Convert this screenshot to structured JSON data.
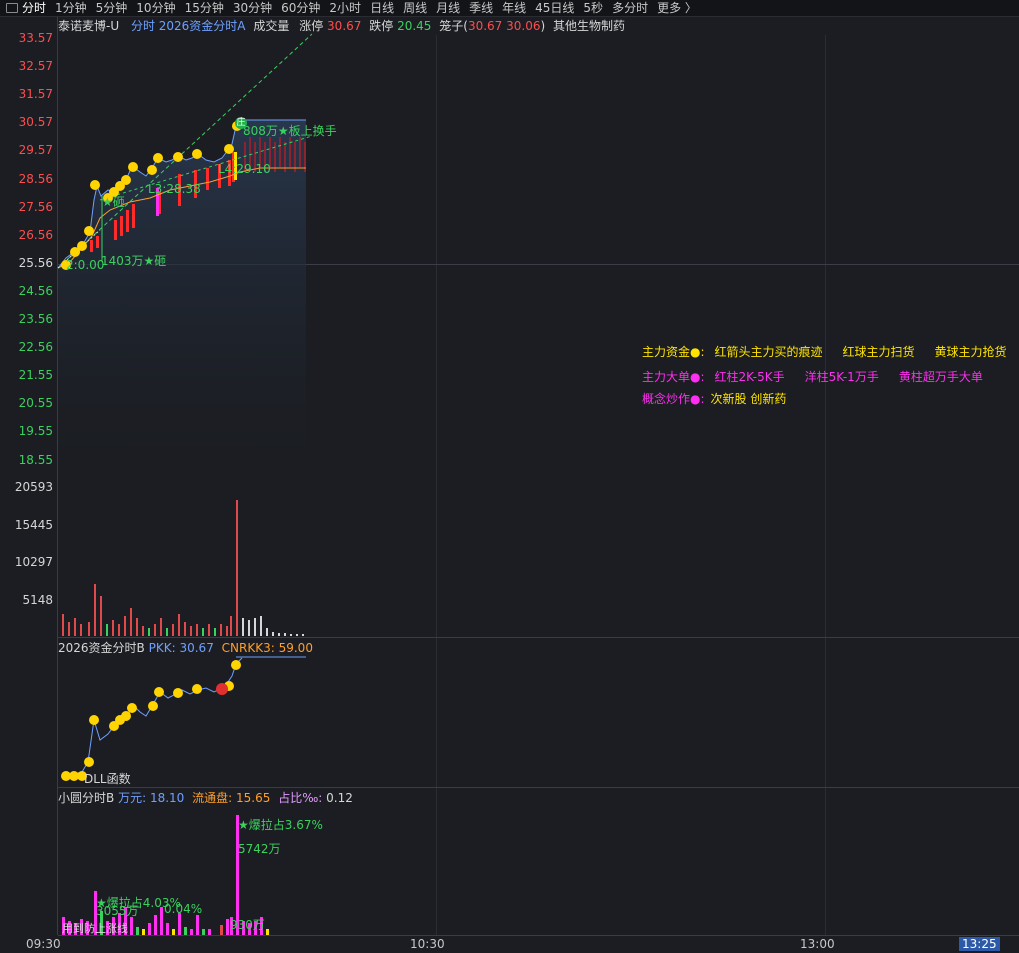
{
  "tabs": [
    "分时",
    "1分钟",
    "5分钟",
    "10分钟",
    "15分钟",
    "30分钟",
    "60分钟",
    "2小时",
    "日线",
    "周线",
    "月线",
    "季线",
    "年线",
    "45日线",
    "5秒",
    "多分时",
    "更多 〉"
  ],
  "header": {
    "stock_name": "泰诺麦博-U",
    "indicator": "分时 2026资金分时A",
    "volume_label": "成交量",
    "limit_up_label": "涨停",
    "limit_up_value": "30.67",
    "limit_down_label": "跌停",
    "limit_down_value": "20.45",
    "cage_label": "笼子(",
    "cage_values": "30.67 30.06",
    "cage_close": ")",
    "sector": "其他生物制药"
  },
  "price_axis": [
    {
      "v": "33.57",
      "c": "red"
    },
    {
      "v": "32.57",
      "c": "red"
    },
    {
      "v": "31.57",
      "c": "red"
    },
    {
      "v": "30.57",
      "c": "red"
    },
    {
      "v": "29.57",
      "c": "red"
    },
    {
      "v": "28.56",
      "c": "red"
    },
    {
      "v": "27.56",
      "c": "red"
    },
    {
      "v": "26.56",
      "c": "red"
    },
    {
      "v": "25.56",
      "c": "wht"
    },
    {
      "v": "24.56",
      "c": "grn"
    },
    {
      "v": "23.56",
      "c": "grn"
    },
    {
      "v": "22.56",
      "c": "grn"
    },
    {
      "v": "21.55",
      "c": "grn"
    },
    {
      "v": "20.55",
      "c": "grn"
    },
    {
      "v": "19.55",
      "c": "grn"
    },
    {
      "v": "18.55",
      "c": "grn"
    }
  ],
  "volume_axis": [
    "20593",
    "15445",
    "10297",
    "5148"
  ],
  "annotations": {
    "a1": "2:0.00",
    "a2": "1403万★砸",
    "a3": "★砸",
    "a4": "L3:28.38",
    "a5": "L4:29.10",
    "a6": "808万★板上换手",
    "sub1_bottom": "DLL函数",
    "burst1": "★爆拉占3.67%",
    "burst1_amt": "5742万",
    "burst2": "★爆拉占4.03%",
    "burst2_amt": "3055万",
    "burst2_pct": "0.04%",
    "burst3_amt": "930万",
    "bottom_left": "用到防上涨线"
  },
  "legend": {
    "row1": {
      "label": "主力资金●:",
      "items": [
        "红箭头主力买的痕迹",
        "红球主力扫货",
        "黄球主力抢货"
      ]
    },
    "row2": {
      "label": "主力大单●:",
      "items": [
        "红柱2K-5K手",
        "洋柱5K-1万手",
        "黄柱超万手大单"
      ]
    },
    "row3": {
      "label": "概念炒作●:",
      "items": [
        "次新股 创新药"
      ]
    }
  },
  "sub1": {
    "title": "2026资金分时B",
    "pkk_label": "PKK:",
    "pkk_value": "30.67",
    "cnr_label": "CNRKK3:",
    "cnr_value": "59.00"
  },
  "sub2": {
    "title": "小圆分时B",
    "wan_label": "万元:",
    "wan_value": "18.10",
    "float_label": "流通盘:",
    "float_value": "15.65",
    "ratio_label": "占比‰:",
    "ratio_value": "0.12"
  },
  "x_axis": {
    "start": "09:30",
    "mid": "10:30",
    "after": "13:00",
    "cursor": "13:25"
  },
  "colors": {
    "up": "#ff4d4d",
    "down": "#3bd15e",
    "price_line": "#6fa0ff",
    "avg_line": "#ff9e2c",
    "yellow_ball": "#ffd400",
    "magenta": "#ff2ef0"
  }
}
